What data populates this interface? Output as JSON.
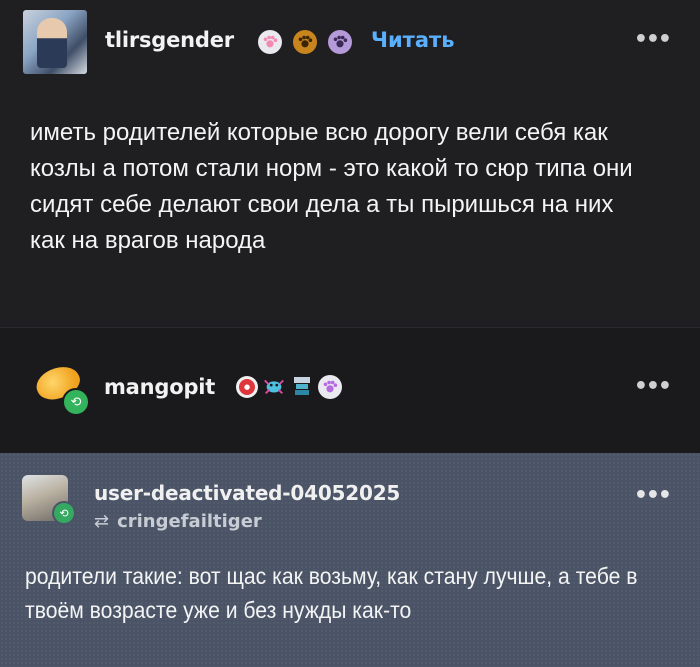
{
  "post1": {
    "username": "tlirsgender",
    "follow_label": "Читать",
    "menu_icon": "more-dots-icon",
    "text": "иметь родителей которые всю дорогу вели себя как козлы а потом стали норм - это какой то сюр типа они сидят себе делают свои дела а ты пыришься на них как на врагов народа",
    "badges": [
      "paw-badge-icon",
      "paw-badge-icon",
      "paw-badge-icon"
    ]
  },
  "post2": {
    "username": "mangopit",
    "menu_icon": "more-dots-icon",
    "badges": [
      "badge-icon",
      "crab-badge-icon",
      "robot-badge-icon",
      "paw-badge-icon"
    ]
  },
  "post3": {
    "username": "user-deactivated-04052025",
    "reblog_from": "cringefailtiger",
    "menu_icon": "more-dots-icon",
    "text": "родители такие: вот щас как возьму, как стану лучше, а тебе в твоём возрасте уже и без нужды как-то"
  },
  "colors": {
    "accent": "#5ab0ff",
    "reblog_green": "#33b35c"
  }
}
